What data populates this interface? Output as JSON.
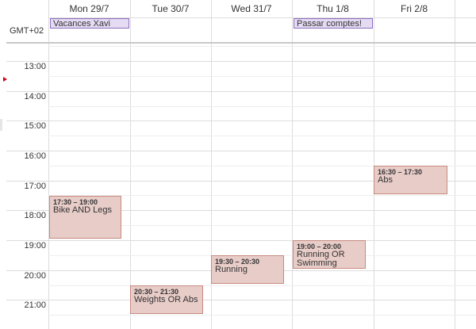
{
  "days": [
    {
      "label": "Mon 29/7"
    },
    {
      "label": "Tue 30/7"
    },
    {
      "label": "Wed 31/7"
    },
    {
      "label": "Thu 1/8"
    },
    {
      "label": "Fri 2/8"
    }
  ],
  "timezone": "GMT+02",
  "times": [
    "13:00",
    "14:00",
    "15:00",
    "16:00",
    "17:00",
    "18:00",
    "19:00",
    "20:00",
    "21:00"
  ],
  "allday_events": [
    {
      "title": "Vacances Xavi",
      "day": "Mon 29/7"
    },
    {
      "title": "Passar comptes!",
      "day": "Thu 1/8"
    }
  ],
  "events": [
    {
      "time": "17:30 – 19:00",
      "title": "Bike AND Legs",
      "day": "Mon 29/7"
    },
    {
      "time": "20:30 – 21:30",
      "title": "Weights OR Abs",
      "day": "Tue 30/7"
    },
    {
      "time": "19:30 – 20:30",
      "title": "Running",
      "day": "Wed 31/7"
    },
    {
      "time": "19:00 – 20:00",
      "title": "Running OR Swimming",
      "day": "Thu 1/8"
    },
    {
      "time": "16:30 – 17:30",
      "title": "Abs",
      "day": "Fri 2/8"
    }
  ],
  "colors": {
    "event_bg": "#e8ccc8",
    "event_border": "#c78a80",
    "allday_bg": "#e5dbf3",
    "allday_border": "#8e6fc2",
    "now_marker": "#d0021b"
  }
}
